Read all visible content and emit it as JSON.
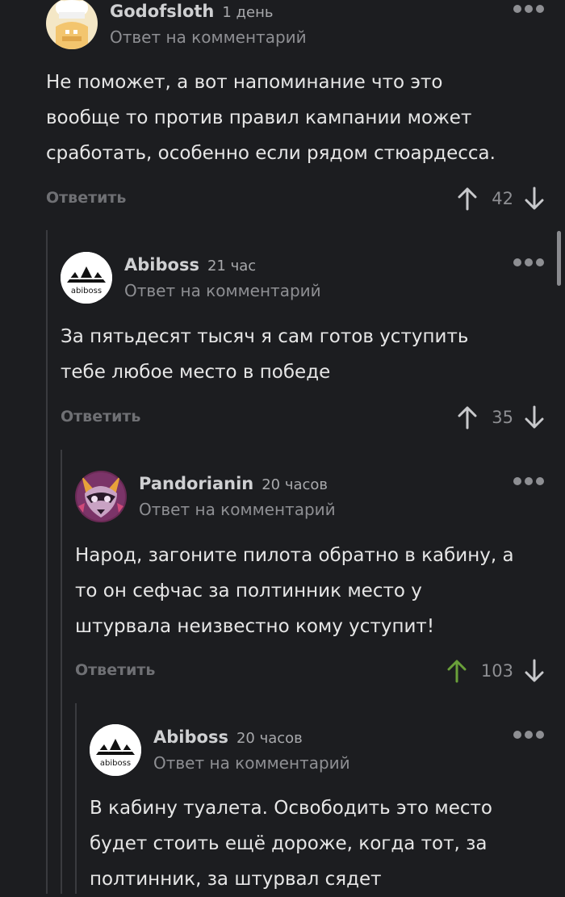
{
  "comments": [
    {
      "author": "Godofsloth",
      "time": "1 день",
      "reply_note": "Ответ на комментарий",
      "text_lines": [
        "Не поможет, а вот напоминание что это",
        "вообще то против правил кампании может",
        "сработать, особенно если рядом стюардесса."
      ],
      "reply_label": "Ответить",
      "votes": "42",
      "upvoted": false,
      "avatar": "cook-avatar"
    },
    {
      "author": "Abiboss",
      "time": "21 час",
      "reply_note": "Ответ на комментарий",
      "text_lines": [
        "За пятьдесят тысяч я сам готов уступить",
        "тебе любое место в победе"
      ],
      "reply_label": "Ответить",
      "votes": "35",
      "upvoted": false,
      "avatar": "abiboss-logo",
      "avatar_text": "abiboss"
    },
    {
      "author": "Pandorianin",
      "time": "20 часов",
      "reply_note": "Ответ на комментарий",
      "text_lines": [
        "Народ, загоните пилота обратно в кабину, а",
        "то он сефчас за полтинник место у",
        "штурвала неизвестно кому уступит!"
      ],
      "reply_label": "Ответить",
      "votes": "103",
      "upvoted": true,
      "avatar": "raccoon-avatar"
    },
    {
      "author": "Abiboss",
      "time": "20 часов",
      "reply_note": "Ответ на комментарий",
      "text_lines": [
        "В кабину туалета. Освободить это место",
        "будет стоить ещё дороже, когда тот, за",
        "полтинник, за штурвал сядет"
      ],
      "avatar": "abiboss-logo",
      "avatar_text": "abiboss"
    }
  ],
  "colors": {
    "background": "#1c1d20",
    "thread_line": "#3a3b3f",
    "upvote_active": "#6aa03a",
    "arrow": "#c8c9cc"
  }
}
